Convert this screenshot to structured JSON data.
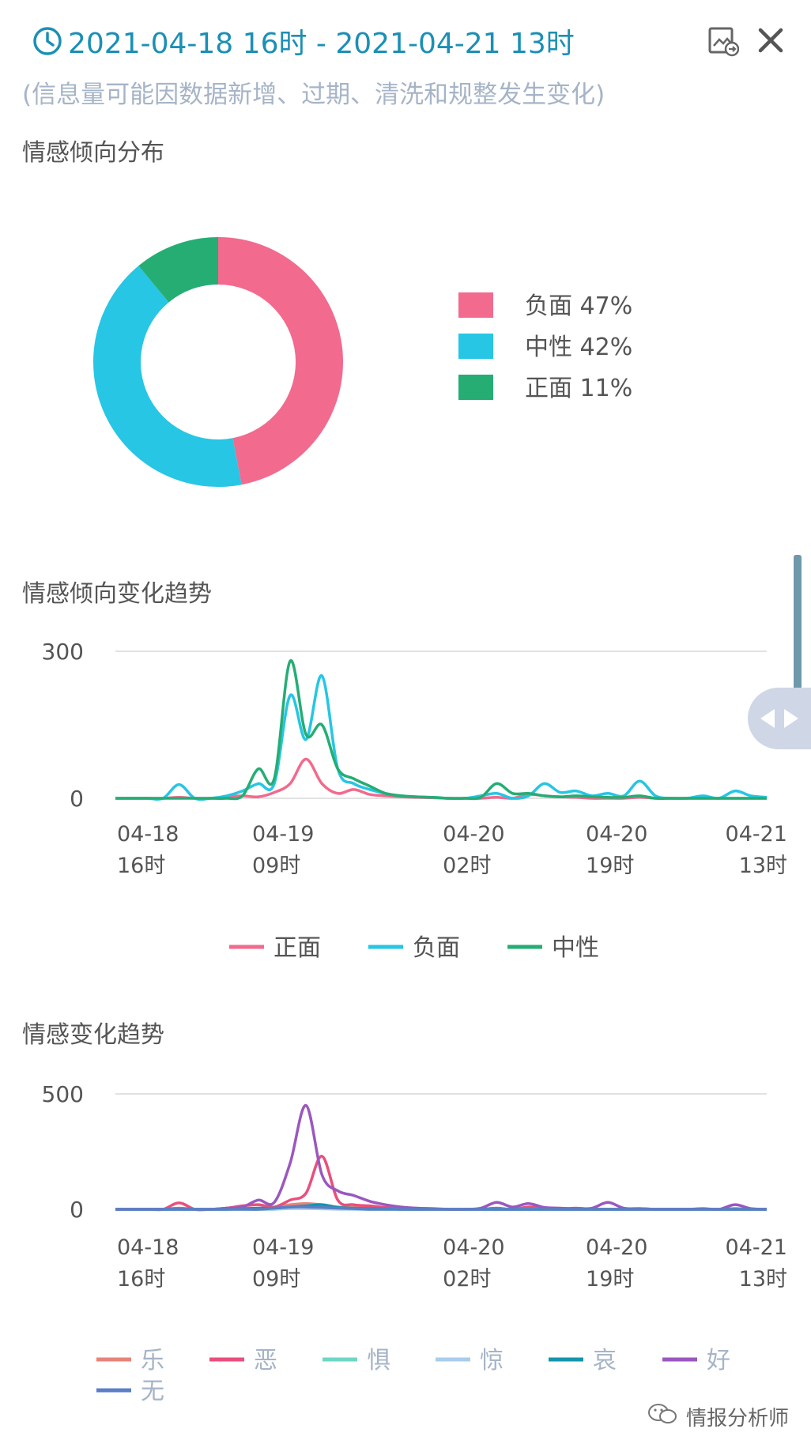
{
  "header": {
    "time_range": "2021-04-18 16时 - 2021-04-21 13时",
    "note": "(信息量可能因数据新增、过期、清洗和规整发生变化)",
    "icons": [
      "clock-icon",
      "export-icon",
      "close-icon"
    ]
  },
  "sections": {
    "distribution_title": "情感倾向分布",
    "polarity_trend_title": "情感倾向变化趋势",
    "emotion_trend_title": "情感变化趋势"
  },
  "colors": {
    "accent": "#1b8fb5",
    "negative": "#f26a8d",
    "neutral": "#26c6e4",
    "positive": "#25ad74"
  },
  "watermark": "情报分析师",
  "chart_data": [
    {
      "type": "pie",
      "donut": true,
      "labels": [
        "负面",
        "中性",
        "正面"
      ],
      "values": [
        47,
        42,
        11
      ],
      "legend_labels": [
        "负面 47%",
        "中性 42%",
        "正面 11%"
      ],
      "colors": [
        "#f26a8d",
        "#26c6e4",
        "#25ad74"
      ],
      "legend": "right"
    },
    {
      "type": "line",
      "x": [
        "04-18 16时",
        "04-18 18时",
        "04-18 20时",
        "04-18 22时",
        "04-19 00时",
        "04-19 02时",
        "04-19 04时",
        "04-19 06时",
        "04-19 07时",
        "04-19 08时",
        "04-19 09时",
        "04-19 10时",
        "04-19 11时",
        "04-19 12时",
        "04-19 13时",
        "04-19 14时",
        "04-19 15时",
        "04-19 16时",
        "04-19 18时",
        "04-19 20时",
        "04-19 22时",
        "04-20 00时",
        "04-20 02时",
        "04-20 04时",
        "04-20 06時",
        "04-20 08时",
        "04-20 10时",
        "04-20 12时",
        "04-20 14时",
        "04-20 16时",
        "04-20 18时",
        "04-20 19时",
        "04-20 20时",
        "04-20 22时",
        "04-21 00时",
        "04-21 02时",
        "04-21 04时",
        "04-21 06时",
        "04-21 08时",
        "04-21 10时",
        "04-21 12时",
        "04-21 13时"
      ],
      "tick_labels": [
        [
          "04-18",
          "16时"
        ],
        [
          "04-19",
          "09时"
        ],
        [
          "04-20",
          "02时"
        ],
        [
          "04-20",
          "19时"
        ],
        [
          "04-21",
          "13时"
        ]
      ],
      "tick_positions": [
        "04-18 16时",
        "04-19 09时",
        "04-20 02时",
        "04-20 19时",
        "04-21 13时"
      ],
      "series": [
        {
          "name": "正面",
          "color": "#f26a8d",
          "values": [
            0,
            0,
            0,
            0,
            2,
            0,
            0,
            3,
            5,
            3,
            12,
            30,
            80,
            30,
            10,
            18,
            8,
            5,
            3,
            2,
            1,
            0,
            0,
            0,
            2,
            0,
            8,
            5,
            3,
            2,
            0,
            0,
            0,
            2,
            0,
            0,
            0,
            0,
            0,
            0,
            0,
            0
          ]
        },
        {
          "name": "负面",
          "color": "#26c6e4",
          "values": [
            0,
            0,
            0,
            0,
            28,
            0,
            0,
            5,
            15,
            30,
            30,
            210,
            120,
            250,
            60,
            30,
            18,
            10,
            5,
            3,
            2,
            0,
            0,
            5,
            10,
            0,
            5,
            30,
            12,
            15,
            5,
            10,
            5,
            35,
            5,
            0,
            0,
            5,
            0,
            15,
            5,
            2
          ]
        },
        {
          "name": "中性",
          "color": "#25ad74",
          "values": [
            0,
            0,
            0,
            0,
            0,
            0,
            0,
            0,
            5,
            60,
            40,
            280,
            130,
            150,
            60,
            40,
            25,
            10,
            5,
            3,
            2,
            0,
            0,
            2,
            30,
            10,
            10,
            5,
            3,
            5,
            3,
            2,
            2,
            5,
            0,
            0,
            0,
            0,
            0,
            0,
            0,
            0
          ]
        }
      ],
      "y_ticks": [
        "300",
        "0"
      ],
      "ylim": [
        0,
        300
      ],
      "grid": true,
      "legend": "bottom"
    },
    {
      "type": "line",
      "x": [
        "04-18 16时",
        "04-18 18时",
        "04-18 20时",
        "04-18 22时",
        "04-19 00时",
        "04-19 02时",
        "04-19 04时",
        "04-19 06时",
        "04-19 07时",
        "04-19 08时",
        "04-19 09时",
        "04-19 10时",
        "04-19 11时",
        "04-19 12时",
        "04-19 13时",
        "04-19 14时",
        "04-19 15时",
        "04-19 16时",
        "04-19 18时",
        "04-19 20时",
        "04-19 22时",
        "04-20 00时",
        "04-20 02时",
        "04-20 04时",
        "04-20 06時",
        "04-20 08时",
        "04-20 10时",
        "04-20 12时",
        "04-20 14时",
        "04-20 16时",
        "04-20 18时",
        "04-20 19时",
        "04-20 20时",
        "04-20 22时",
        "04-21 00时",
        "04-21 02时",
        "04-21 04时",
        "04-21 06时",
        "04-21 08时",
        "04-21 10时",
        "04-21 12时",
        "04-21 13时"
      ],
      "tick_labels": [
        [
          "04-18",
          "16时"
        ],
        [
          "04-19",
          "09时"
        ],
        [
          "04-20",
          "02时"
        ],
        [
          "04-20",
          "19时"
        ],
        [
          "04-21",
          "13时"
        ]
      ],
      "tick_positions": [
        "04-18 16时",
        "04-19 09时",
        "04-20 02时",
        "04-20 19时",
        "04-21 13时"
      ],
      "series": [
        {
          "name": "乐",
          "color": "#e8837b",
          "values": [
            0,
            0,
            0,
            0,
            5,
            0,
            0,
            3,
            5,
            5,
            8,
            20,
            25,
            20,
            10,
            8,
            5,
            3,
            2,
            0,
            0,
            0,
            0,
            0,
            2,
            0,
            3,
            2,
            0,
            0,
            0,
            0,
            0,
            0,
            0,
            0,
            0,
            0,
            0,
            0,
            0,
            0
          ]
        },
        {
          "name": "恶",
          "color": "#ea4f7b",
          "values": [
            0,
            0,
            0,
            0,
            28,
            0,
            0,
            5,
            15,
            20,
            10,
            40,
            70,
            230,
            40,
            20,
            15,
            8,
            3,
            2,
            0,
            0,
            0,
            0,
            5,
            0,
            10,
            5,
            0,
            5,
            0,
            0,
            0,
            3,
            0,
            0,
            0,
            0,
            0,
            3,
            0,
            0
          ]
        },
        {
          "name": "惧",
          "color": "#6fd6c6",
          "values": [
            0,
            0,
            0,
            0,
            0,
            0,
            0,
            0,
            0,
            0,
            0,
            5,
            5,
            3,
            2,
            0,
            0,
            0,
            0,
            0,
            0,
            0,
            0,
            0,
            0,
            0,
            0,
            0,
            0,
            0,
            0,
            0,
            0,
            0,
            0,
            0,
            0,
            0,
            0,
            0,
            0,
            0
          ]
        },
        {
          "name": "惊",
          "color": "#a9cdeb",
          "values": [
            0,
            0,
            0,
            0,
            0,
            0,
            0,
            0,
            0,
            0,
            0,
            3,
            3,
            2,
            0,
            0,
            0,
            0,
            0,
            0,
            0,
            0,
            0,
            0,
            0,
            0,
            0,
            0,
            0,
            0,
            0,
            0,
            0,
            0,
            0,
            0,
            0,
            0,
            0,
            0,
            0,
            0
          ]
        },
        {
          "name": "哀",
          "color": "#1495ab",
          "values": [
            0,
            0,
            0,
            0,
            0,
            0,
            0,
            0,
            2,
            5,
            5,
            10,
            15,
            20,
            8,
            5,
            3,
            2,
            0,
            0,
            0,
            0,
            0,
            0,
            0,
            0,
            0,
            0,
            0,
            0,
            0,
            0,
            0,
            0,
            0,
            0,
            0,
            0,
            0,
            0,
            0,
            0
          ]
        },
        {
          "name": "好",
          "color": "#9a58bf",
          "values": [
            0,
            0,
            0,
            0,
            3,
            0,
            0,
            5,
            10,
            40,
            30,
            200,
            450,
            150,
            80,
            60,
            35,
            20,
            10,
            5,
            3,
            0,
            0,
            5,
            30,
            10,
            25,
            8,
            5,
            3,
            5,
            30,
            5,
            3,
            0,
            0,
            0,
            3,
            0,
            20,
            3,
            0
          ]
        },
        {
          "name": "无",
          "color": "#5a7fc4",
          "values": [
            0,
            0,
            0,
            0,
            0,
            0,
            0,
            0,
            0,
            0,
            5,
            10,
            10,
            8,
            5,
            3,
            0,
            0,
            0,
            0,
            0,
            0,
            0,
            0,
            0,
            0,
            0,
            0,
            0,
            0,
            0,
            0,
            0,
            0,
            0,
            0,
            0,
            0,
            0,
            0,
            0,
            0
          ]
        }
      ],
      "y_ticks": [
        "500",
        "0"
      ],
      "ylim": [
        0,
        500
      ],
      "grid": true,
      "legend": "bottom"
    }
  ]
}
